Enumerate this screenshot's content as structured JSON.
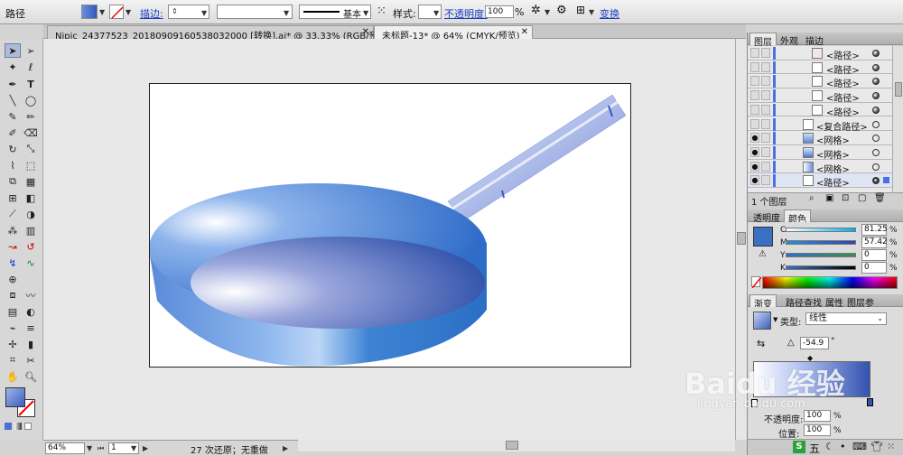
{
  "control_bar": {
    "object_type": "路径",
    "stroke_label": "描边:",
    "stroke_style": "基本",
    "style_label": "样式:",
    "opacity_label": "不透明度:",
    "opacity_value": "100",
    "opacity_unit": "%",
    "transform_label": "变换"
  },
  "tabs": [
    {
      "label": "Nipic_24377523_20180909160538032000 [转换].ai* @ 33.33% (RGB/预览)",
      "active": false
    },
    {
      "label": "未标题-13* @ 64% (CMYK/预览)",
      "active": true
    }
  ],
  "layers_panel": {
    "tabs": [
      "图层",
      "外观",
      "描边"
    ],
    "rows": [
      {
        "name": "<路径>",
        "visible": false,
        "target": "filled"
      },
      {
        "name": "<路径>",
        "visible": false,
        "target": "filled"
      },
      {
        "name": "<路径>",
        "visible": false,
        "target": "filled"
      },
      {
        "name": "<路径>",
        "visible": false,
        "target": "filled"
      },
      {
        "name": "<路径>",
        "visible": false,
        "target": "filled"
      },
      {
        "name": "<复合路径>",
        "visible": false,
        "target": "empty"
      },
      {
        "name": "<网格>",
        "visible": true,
        "target": "empty"
      },
      {
        "name": "<网格>",
        "visible": true,
        "target": "empty"
      },
      {
        "name": "<网格>",
        "visible": true,
        "target": "empty"
      },
      {
        "name": "<路径>",
        "visible": true,
        "target": "selected"
      }
    ],
    "footer": "1 个图层"
  },
  "color_panel": {
    "tabs": [
      "透明度",
      "颜色"
    ],
    "channels": [
      {
        "label": "C",
        "value": "81.25",
        "unit": "%"
      },
      {
        "label": "M",
        "value": "57.42",
        "unit": "%"
      },
      {
        "label": "Y",
        "value": "0",
        "unit": "%"
      },
      {
        "label": "K",
        "value": "0",
        "unit": "%"
      }
    ],
    "fill_color": "#3b6fc4"
  },
  "gradient_panel": {
    "tabs": [
      "渐变",
      "路径查找",
      "属性",
      "图层参"
    ],
    "type_label": "类型:",
    "type_value": "线性",
    "angle_value": "-54.9",
    "angle_unit": "°",
    "opacity_label": "不透明度:",
    "opacity_value": "100",
    "location_label": "位置:",
    "location_value": "100",
    "unit": "%"
  },
  "status_bar": {
    "zoom": "64%",
    "page": "1",
    "undo": "27 次还原；无重做"
  },
  "watermark": {
    "brand": "Baidu 经验",
    "url": "jingyan.baidu.com"
  },
  "ime": {
    "label": "五"
  }
}
